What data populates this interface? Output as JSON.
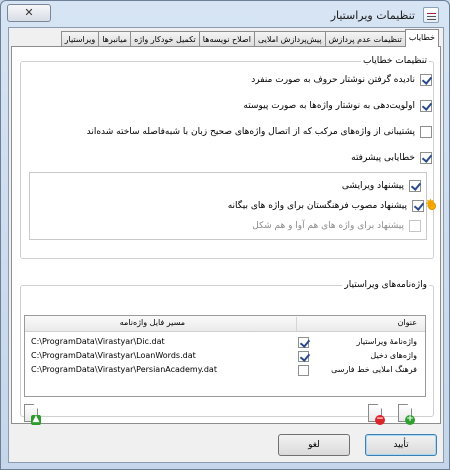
{
  "window": {
    "title": "تنظیمات ویراستیار",
    "close_symbol": "✕"
  },
  "tabs": [
    {
      "label": "خطایاب"
    },
    {
      "label": "تنظیمات عدم پردازش"
    },
    {
      "label": "پیش‌پردازش املایی"
    },
    {
      "label": "اصلاح نویسه‌ها"
    },
    {
      "label": "تکمیل خودکار واژه"
    },
    {
      "label": "میانبرها"
    },
    {
      "label": "ویراستیار"
    }
  ],
  "spell_settings": {
    "group_label": "تنظیمات خطایاب",
    "options": [
      {
        "label": "نادیده گرفتن نوشتار حروف به صورت منفرد",
        "checked": true
      },
      {
        "label": "اولویت‌دهی به نوشتار واژه‌ها به صورت پیوسته",
        "checked": true
      },
      {
        "label": "پشتیبانی از واژه‌های مرکب که از اتصال واژه‌های صحیح زبان با شبه‌فاصله ساخته شده‌اند",
        "checked": false
      },
      {
        "label": "خطایابی پیشرفته",
        "checked": true
      }
    ],
    "sub_options": [
      {
        "label": "پیشنهاد ویرایشی",
        "checked": true,
        "disabled": false
      },
      {
        "label": "پیشنهاد مصوب فرهنگستان برای واژه های بیگانه",
        "checked": true,
        "disabled": false,
        "icon": "sun-icon"
      },
      {
        "label": "پیشنهاد برای واژه های هم آوا و هم شکل",
        "checked": false,
        "disabled": true
      }
    ]
  },
  "dictionaries": {
    "group_label": "واژه‌نامه‌های ویراستیار",
    "columns": {
      "title": "عنوان",
      "path": "مسیر فایل واژه‌نامه"
    },
    "rows": [
      {
        "name": "واژه‌نامهٔ ویراستیار",
        "checked": true,
        "path": "C:\\ProgramData\\Virastyar\\Dic.dat"
      },
      {
        "name": "واژه‌های دخیل",
        "checked": true,
        "path": "C:\\ProgramData\\Virastyar\\LoanWords.dat"
      },
      {
        "name": "فرهنگ املایی خط فارسی",
        "checked": false,
        "path": "C:\\ProgramData\\Virastyar\\PersianAcademy.dat"
      }
    ]
  },
  "buttons": {
    "ok": "تأیید",
    "cancel": "لغو"
  }
}
